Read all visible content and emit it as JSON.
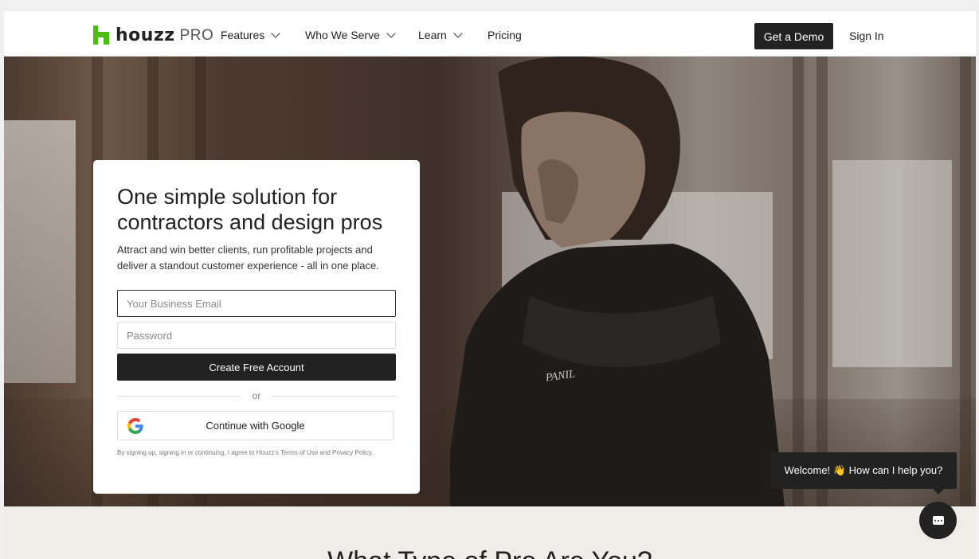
{
  "nav": {
    "brand_word": "houzz",
    "brand_pro": "PRO",
    "items": [
      {
        "label": "Features",
        "has_dropdown": true
      },
      {
        "label": "Who We Serve",
        "has_dropdown": true
      },
      {
        "label": "Learn",
        "has_dropdown": true
      },
      {
        "label": "Pricing",
        "has_dropdown": false
      }
    ],
    "demo_label": "Get a Demo",
    "signin_label": "Sign In",
    "brand_color": "#4dbc15"
  },
  "signup": {
    "title": "One simple solution for contractors and design pros",
    "subtitle": "Attract and win better clients, run profitable projects and deliver a standout customer experience - all in one place.",
    "email_placeholder": "Your Business Email",
    "password_placeholder": "Password",
    "create_label": "Create Free Account",
    "or_label": "or",
    "google_label": "Continue with Google",
    "legal_prefix": "By signing up, signing in or continuing, I agree to Houzz's ",
    "terms_label": "Terms of Use",
    "legal_and": " and ",
    "privacy_label": "Privacy Policy",
    "legal_suffix": "."
  },
  "hero": {
    "shirt_text": "PANIL"
  },
  "lower": {
    "heading": "What Type of Pro Are You?"
  },
  "chat": {
    "tooltip": "Welcome! 👋 How can I help you?"
  }
}
